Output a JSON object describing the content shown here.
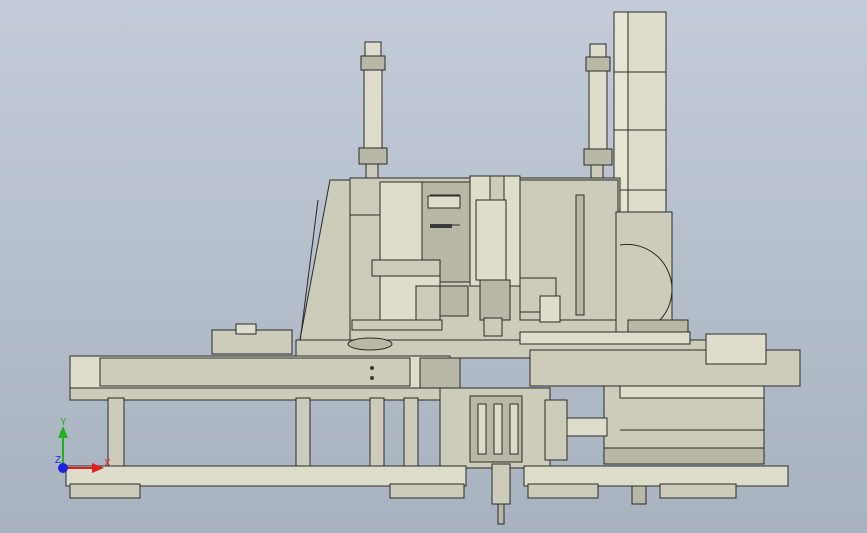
{
  "viewport": {
    "background_top": "#c3ccd8",
    "background_bottom": "#a9b2bf"
  },
  "model": {
    "part_color": "#cdcbb9",
    "edge_color": "#2b2b2b"
  },
  "triad": {
    "x_label": "X",
    "y_label": "Y",
    "z_label": "Z",
    "x_color": "#e02020",
    "y_color": "#20b020",
    "z_color": "#2020e0"
  }
}
